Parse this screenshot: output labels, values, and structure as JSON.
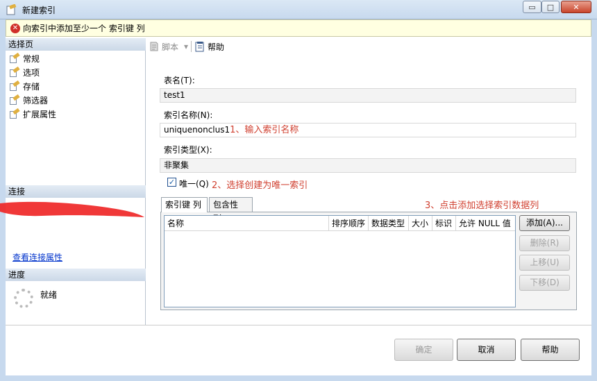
{
  "window": {
    "title": "新建索引",
    "minimize": "▭",
    "maximize": "□",
    "close": "✕"
  },
  "error_bar": {
    "message": "向索引中添加至少一个 索引键 列",
    "icon": "error-icon"
  },
  "left_panel": {
    "select_page_header": "选择页",
    "pages": [
      {
        "label": "常规",
        "icon": "page-icon"
      },
      {
        "label": "选项",
        "icon": "page-icon"
      },
      {
        "label": "存储",
        "icon": "page-icon"
      },
      {
        "label": "筛选器",
        "icon": "page-icon"
      },
      {
        "label": "扩展属性",
        "icon": "page-icon"
      }
    ],
    "connection_header": "连接",
    "connection_link": "查看连接属性",
    "progress_header": "进度",
    "progress_status": "就绪"
  },
  "toolbar": {
    "script_label": "脚本",
    "script_dropdown": "▾",
    "help_label": "帮助"
  },
  "form": {
    "table_name_label": "表名(T):",
    "table_name_value": "test1",
    "index_name_label": "索引名称(N):",
    "index_name_value": "uniquenonclus1",
    "index_type_label": "索引类型(X):",
    "index_type_value": "非聚集",
    "unique_label": "唯一(Q)",
    "unique_checked": "✓"
  },
  "annotations": {
    "step1": "1、输入索引名称",
    "step2": "2、选择创建为唯一索引",
    "step3": "3、点击添加选择索引数据列"
  },
  "tabs": [
    {
      "label": "索引键 列"
    },
    {
      "label": "包含性 列"
    }
  ],
  "grid_columns": [
    "名称",
    "排序顺序",
    "数据类型",
    "大小",
    "标识",
    "允许 NULL 值"
  ],
  "side_buttons": {
    "add": "添加(A)...",
    "remove": "删除(R)",
    "move_up": "上移(U)",
    "move_down": "下移(D)"
  },
  "dialog_buttons": {
    "ok": "确定",
    "cancel": "取消",
    "help": "帮助"
  },
  "colors": {
    "annotation": "#d04030",
    "link": "#0033cc",
    "error_bg": "#ffffe1"
  }
}
